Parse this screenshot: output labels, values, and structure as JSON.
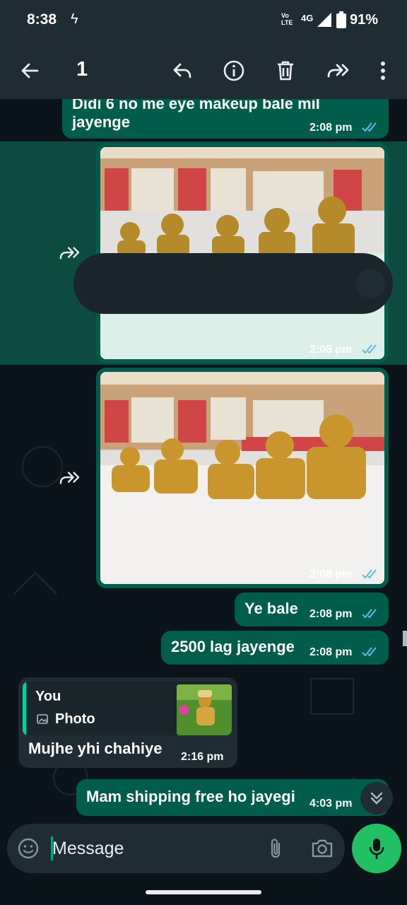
{
  "status_bar": {
    "time": "8:38",
    "network_volte": "Vo LTE",
    "network_type": "4G",
    "battery_percent": "91%"
  },
  "action_bar": {
    "selected_count": "1",
    "icons": [
      "back-arrow-icon",
      "reply-icon",
      "info-icon",
      "delete-icon",
      "forward-icon",
      "overflow-menu-icon"
    ]
  },
  "messages": [
    {
      "text": "Didi 6 no me eye makeup bale mil",
      "text2": "jayenge",
      "time": "2:08 pm",
      "direction": "out",
      "status": "read"
    },
    {
      "type": "image",
      "time": "2:08 pm",
      "direction": "out",
      "selected": true
    },
    {
      "type": "image",
      "time": "2:08 pm",
      "direction": "out"
    },
    {
      "text": "Ye bale",
      "time": "2:08 pm",
      "direction": "out",
      "status": "read"
    },
    {
      "text": "2500 lag jayenge",
      "time": "2:08 pm",
      "direction": "out",
      "status": "read"
    },
    {
      "text": "Mujhe yhi chahiye",
      "time": "2:16 pm",
      "direction": "in",
      "quote": {
        "author": "You",
        "type": "Photo"
      }
    },
    {
      "text": "Mam shipping free ho jayegi",
      "time": "4:03 pm",
      "direction": "out"
    }
  ],
  "composer": {
    "placeholder": "Message"
  },
  "colors": {
    "header": "#1f2c34",
    "background": "#0b141a",
    "outgoing_bubble": "#005c4b",
    "incoming_bubble": "#1f2c34",
    "selection": "#0d4a3f",
    "read_ticks": "#53bdeb",
    "accent": "#21c063"
  }
}
